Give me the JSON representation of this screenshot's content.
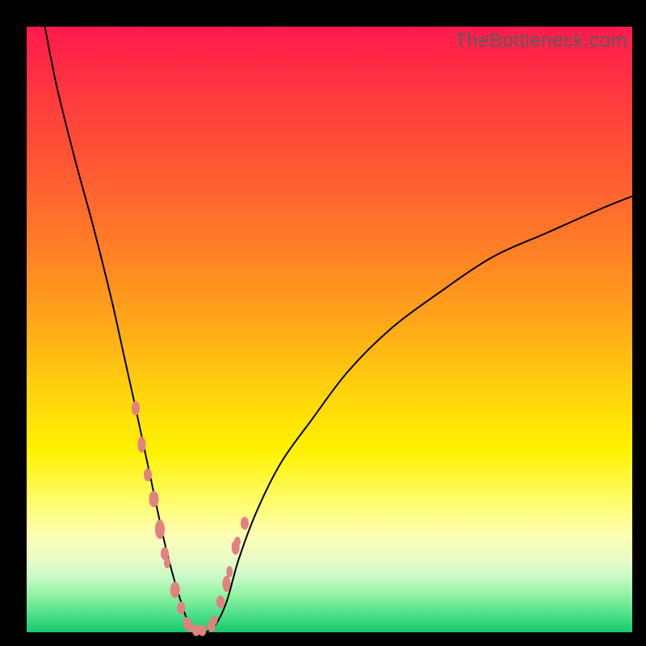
{
  "watermark": "TheBottleneck.com",
  "colors": {
    "frame": "#000000",
    "curve": "#000000",
    "marker": "#e38080",
    "gradient_top": "#ff1a4d",
    "gradient_bottom": "#15c96b"
  },
  "chart_data": {
    "type": "line",
    "title": "",
    "xlabel": "",
    "ylabel": "",
    "xlim": [
      0,
      100
    ],
    "ylim": [
      0,
      100
    ],
    "series": [
      {
        "name": "bottleneck-curve",
        "x": [
          3,
          5,
          8,
          11,
          14,
          16,
          18,
          19.5,
          21,
          22.5,
          24,
          25.5,
          27,
          29,
          31,
          33,
          35,
          38,
          42,
          47,
          53,
          60,
          68,
          77,
          86,
          95,
          100
        ],
        "y": [
          100,
          90,
          78,
          67,
          55,
          46,
          37,
          30,
          23,
          16,
          10,
          5,
          1,
          0,
          1,
          5,
          12,
          20,
          28,
          35,
          43,
          50,
          56,
          62,
          66,
          70,
          72
        ]
      }
    ],
    "markers": {
      "name": "highlighted-points",
      "x": [
        18,
        19,
        20,
        21,
        22,
        22.8,
        23.2,
        24.5,
        25.5,
        26.5,
        27,
        28,
        29,
        30.5,
        31,
        32,
        33,
        33.5,
        34.5,
        34.8,
        36
      ],
      "y": [
        37,
        31,
        26,
        22,
        17,
        13,
        11.5,
        7,
        4,
        1.5,
        0.8,
        0.3,
        0.3,
        1,
        2,
        5,
        8,
        10,
        14,
        15,
        18
      ],
      "rx": [
        5,
        5,
        5,
        6,
        6,
        5,
        4,
        6,
        5,
        5,
        4,
        5,
        5,
        5,
        4,
        5,
        5,
        4,
        5,
        4,
        5
      ],
      "ry": [
        9,
        10,
        8,
        10,
        12,
        8,
        7,
        10,
        8,
        8,
        6,
        7,
        7,
        7,
        6,
        8,
        10,
        7,
        9,
        6,
        8
      ]
    }
  }
}
